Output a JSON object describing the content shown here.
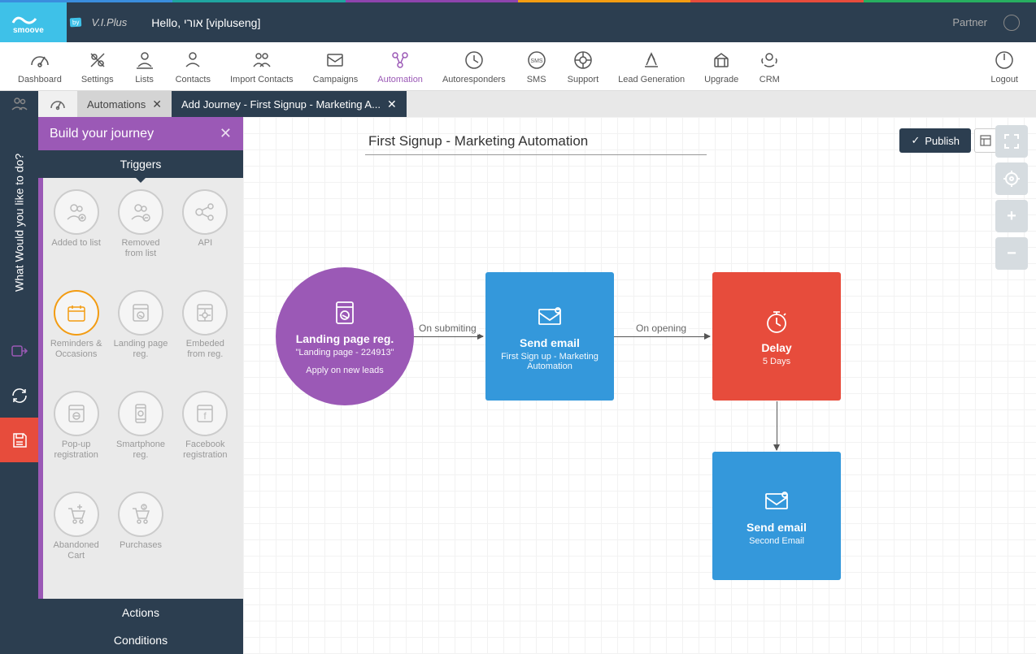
{
  "brand": {
    "name": "smoove",
    "by": "by",
    "partner_brand": "V.I.Plus"
  },
  "header": {
    "hello_prefix": "Hello, ",
    "user": "אורי [vipluseng]",
    "partner_link": "Partner"
  },
  "toolbar": {
    "items": [
      "Dashboard",
      "Settings",
      "Lists",
      "Contacts",
      "Import Contacts",
      "Campaigns",
      "Automation",
      "Autoresponders",
      "SMS",
      "Support",
      "Lead Generation",
      "Upgrade",
      "CRM"
    ],
    "logout": "Logout",
    "active_index": 6
  },
  "tabs": {
    "tab1": "Automations",
    "tab2": "Add Journey - First Signup - Marketing A..."
  },
  "sidebar": {
    "vertical_label": "What Would you like to do?"
  },
  "panel": {
    "title": "Build your journey",
    "sections": {
      "triggers": "Triggers",
      "actions": "Actions",
      "conditions": "Conditions"
    },
    "triggers": [
      "Added to list",
      "Removed from list",
      "API",
      "Reminders & Occasions",
      "Landing page reg.",
      "Embeded from reg.",
      "Pop-up registration",
      "Smartphone reg.",
      "Facebook registration",
      "Abandoned Cart",
      "Purchases"
    ]
  },
  "canvas": {
    "title": "First Signup - Marketing Automation",
    "publish": "Publish",
    "node1": {
      "title": "Landing page reg.",
      "sub1": "\"Landing page - 224913\"",
      "sub2": "Apply on new leads"
    },
    "conn1": "On submiting",
    "node2": {
      "title": "Send email",
      "sub": "First Sign up - Marketing Automation"
    },
    "conn2": "On opening",
    "node3": {
      "title": "Delay",
      "sub": "5 Days"
    },
    "node4": {
      "title": "Send email",
      "sub": "Second Email"
    }
  }
}
